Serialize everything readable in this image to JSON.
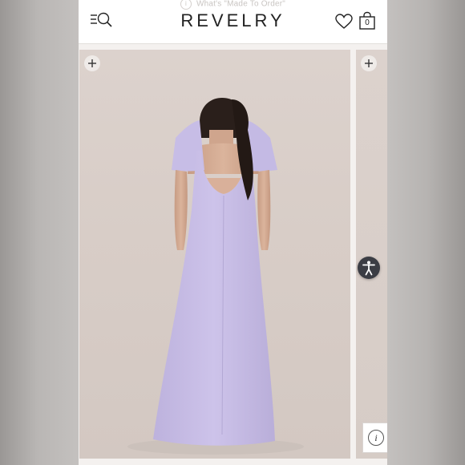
{
  "banner": {
    "text": "What's \"Made To Order\"",
    "info_icon": "i"
  },
  "header": {
    "brand": "REVELRY",
    "bag_count": "0",
    "icons": {
      "menu": "menu-search-icon",
      "wishlist": "heart-icon",
      "bag": "shopping-bag-icon"
    }
  },
  "gallery": {
    "zoom_icon": "zoom-in-icon",
    "dress_color": "#c9bfe6",
    "background_color": "#d9cfca"
  },
  "accessibility": {
    "icon": "accessibility-icon",
    "color": "#3b3d44"
  },
  "info_button": {
    "label": "i"
  }
}
